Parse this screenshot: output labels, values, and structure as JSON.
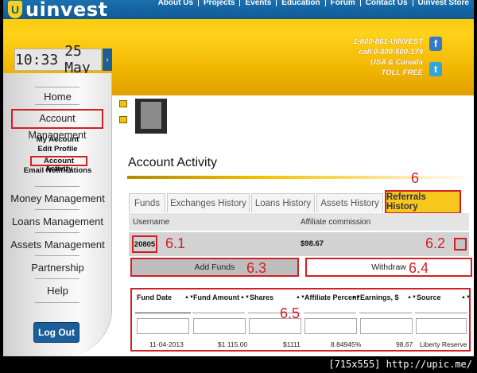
{
  "brand": {
    "name": "uinvest",
    "mark": "U"
  },
  "top_nav": [
    "About Us",
    "Projects",
    "Events",
    "Education",
    "Forum",
    "Contact Us",
    "Uinvest Store"
  ],
  "contact": {
    "line1": "1-800-861-UINVEST",
    "line2": "call 0-800-500-179",
    "line3": "USA & Canada",
    "line4": "TOLL FREE"
  },
  "social": {
    "facebook": "f",
    "twitter": "t"
  },
  "clock": {
    "time": "10:33",
    "date": "25 May",
    "toggle": "›"
  },
  "sidebar": {
    "home": "Home",
    "account_management": "Account Management",
    "sub_items": [
      "My Account",
      "Edit Profile",
      "Account Activity",
      "Email Notifications"
    ],
    "money_management": "Money Management",
    "loans_management": "Loans Management",
    "assets_management": "Assets Management",
    "partnership": "Partnership",
    "help": "Help",
    "logout": "Log Out"
  },
  "page_title": "Account Activity",
  "tabs": [
    "Funds",
    "Exchanges History",
    "Loans History",
    "Assets History",
    "Referrals History"
  ],
  "active_tab": "Referrals History",
  "referral": {
    "username_header": "Username",
    "commission_header": "Affiliate commission",
    "username": "20805",
    "commission": "$98.67"
  },
  "actions": {
    "add_funds": "Add Funds",
    "withdraw": "Withdraw"
  },
  "table": {
    "columns": [
      "Fund Date",
      "Fund Amount",
      "Shares",
      "Affiliate Percent",
      "Earnings, $",
      "Source"
    ],
    "sort_icon": "▲▼",
    "rows": [
      [
        "11-04-2013",
        "$1 115.00",
        "$1111",
        "8.84945%",
        "98.67",
        "Liberty Reserve"
      ]
    ]
  },
  "annotations": {
    "tab": "6",
    "username": "6.1",
    "close": "6.2",
    "add": "6.3",
    "withdraw": "6.4",
    "table": "6.5"
  },
  "watermark": "[715x555] http://upic.me/",
  "colors": {
    "brand_blue": "#1b5e9a",
    "gold": "#f5c200",
    "annotation_red": "#d21f24"
  }
}
